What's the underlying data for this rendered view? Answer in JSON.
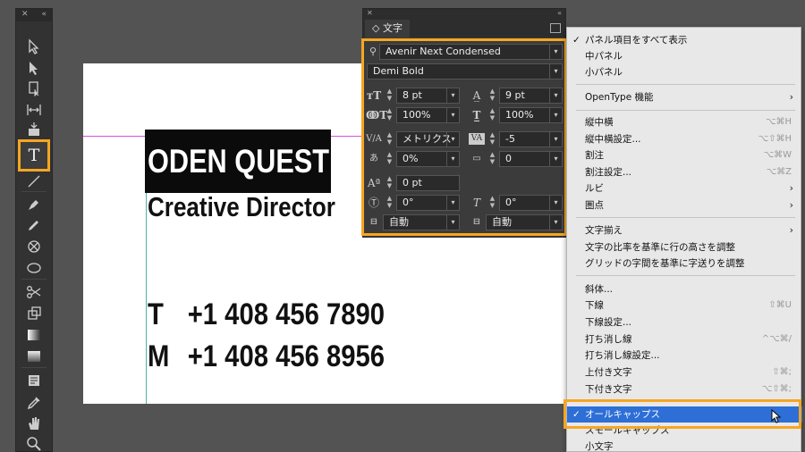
{
  "toolbar": {
    "icons": [
      "selection-icon",
      "direct-selection-icon",
      "page-icon",
      "gap-icon",
      "content-collector-icon",
      "type-icon",
      "line-icon",
      "pen-icon",
      "pencil-icon",
      "rectangle-frame-icon",
      "ellipse-icon",
      "scissors-icon",
      "free-transform-icon",
      "gradient-swatch-icon",
      "gradient-feather-icon",
      "note-icon",
      "eyedropper-icon",
      "hand-icon",
      "zoom-icon"
    ],
    "type_tool_glyph": "T"
  },
  "artboard": {
    "title": "ODEN QUEST",
    "subtitle": "Creative Director",
    "lines": [
      {
        "label": "T",
        "number": "+1 408 456 7890"
      },
      {
        "label": "M",
        "number": "+1 408 456 8956"
      }
    ]
  },
  "character_panel": {
    "tab_label": "文字",
    "tab_prefix": "◇",
    "font_family": "Avenir Next Condensed",
    "font_style": "Demi Bold",
    "font_size": "8 pt",
    "leading": "9 pt",
    "vertical_scale": "100%",
    "horizontal_scale": "100%",
    "kerning": "メトリクス",
    "tracking": "-5",
    "tsume": "0%",
    "grid_count": "0",
    "baseline_shift": "0 pt",
    "rotation": "0°",
    "skew": "0°",
    "aki_before": "自動",
    "aki_after": "自動"
  },
  "flyout_menu": {
    "items": [
      {
        "label": "パネル項目をすべて表示",
        "checked": true
      },
      {
        "label": "中パネル"
      },
      {
        "label": "小パネル"
      },
      {
        "label": "OpenType 機能",
        "submenu": true
      },
      {
        "label": "縦中横",
        "shortcut": "⌥⌘H"
      },
      {
        "label": "縦中横設定...",
        "shortcut": "⌥⇧⌘H"
      },
      {
        "label": "割注",
        "shortcut": "⌥⌘W"
      },
      {
        "label": "割注設定...",
        "shortcut": "⌥⌘Z"
      },
      {
        "label": "ルビ",
        "submenu": true
      },
      {
        "label": "圏点",
        "submenu": true
      },
      {
        "label": "文字揃え",
        "submenu": true
      },
      {
        "label": "文字の比率を基準に行の高さを調整"
      },
      {
        "label": "グリッドの字間を基準に字送りを調整"
      },
      {
        "label": "斜体..."
      },
      {
        "label": "下線",
        "shortcut": "⇧⌘U"
      },
      {
        "label": "下線設定..."
      },
      {
        "label": "打ち消し線",
        "shortcut": "^⌥⌘/"
      },
      {
        "label": "打ち消し線設定..."
      },
      {
        "label": "上付き文字",
        "shortcut": "⇧⌘;"
      },
      {
        "label": "下付き文字",
        "shortcut": "⌥⇧⌘;"
      },
      {
        "label": "オールキャップス",
        "checked": true,
        "selected": true
      },
      {
        "label": "スモールキャップス"
      },
      {
        "label": "小文字"
      }
    ]
  },
  "colors": {
    "highlight": "#f5a623",
    "menu_selection": "#2d6fd6",
    "guide_magenta": "#d850d8",
    "guide_teal": "#4fb3a0"
  }
}
